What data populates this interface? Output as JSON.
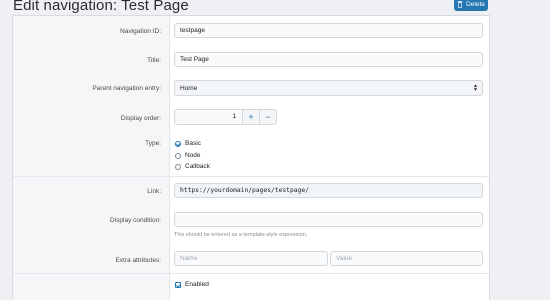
{
  "page": {
    "title": "Edit navigation: Test Page",
    "delete_label": "Delete",
    "delete_icon": "trash-icon"
  },
  "form": {
    "navigation_id": {
      "label": "Navigation ID:",
      "value": "testpage"
    },
    "title": {
      "label": "Title:",
      "value": "Test Page"
    },
    "parent_entry": {
      "label": "Parent navigation entry:",
      "value": "Home"
    },
    "display_order": {
      "label": "Display order:",
      "value": "1",
      "increment": "+",
      "decrement": "−"
    },
    "type": {
      "label": "Type:",
      "options": [
        "Basic",
        "Node",
        "Callback"
      ],
      "selected": "Basic"
    },
    "link": {
      "label": "Link:",
      "value": "https://yourdomain/pages/testpage/"
    },
    "display_condition": {
      "label": "Display condition:",
      "value": "",
      "hint": "This should be entered as a template-style expression."
    },
    "extra_attributes": {
      "label": "Extra attributes:",
      "name_placeholder": "Name",
      "value_placeholder": "Value"
    },
    "enabled": {
      "label": "Enabled",
      "checked": true
    }
  },
  "colors": {
    "accent": "#2577b1",
    "label_background": "#f5f6f8",
    "page_background": "#eef0f3"
  }
}
